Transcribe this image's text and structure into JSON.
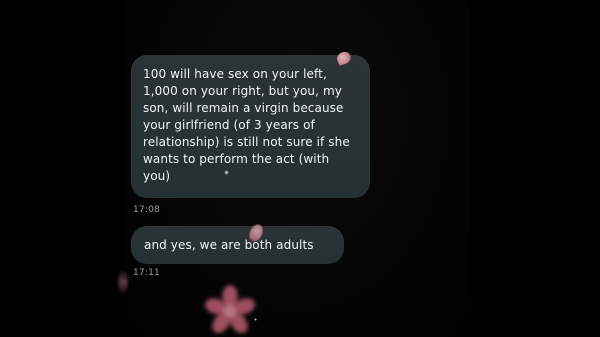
{
  "conversation": {
    "messages": [
      {
        "text": "100 will have sex on your left,\n1,000 on your right, but you, my\nson, will remain a virgin because\nyour girlfriend (of 3 years of\nrelationship) is still not sure if she\nwants to perform the act (with\nyou)",
        "time": "17:08"
      },
      {
        "text": "and yes, we are both adults",
        "time": "17:11"
      }
    ]
  },
  "decorations": {
    "icons": [
      "petal",
      "petal",
      "petal",
      "flower",
      "sparkle"
    ],
    "colors": {
      "background": "#000000",
      "bubble": "#2b3335",
      "bubble_text": "#f3f5f6",
      "timestamp": "#9aa0a3",
      "petal_pink": "#d98a98"
    }
  }
}
